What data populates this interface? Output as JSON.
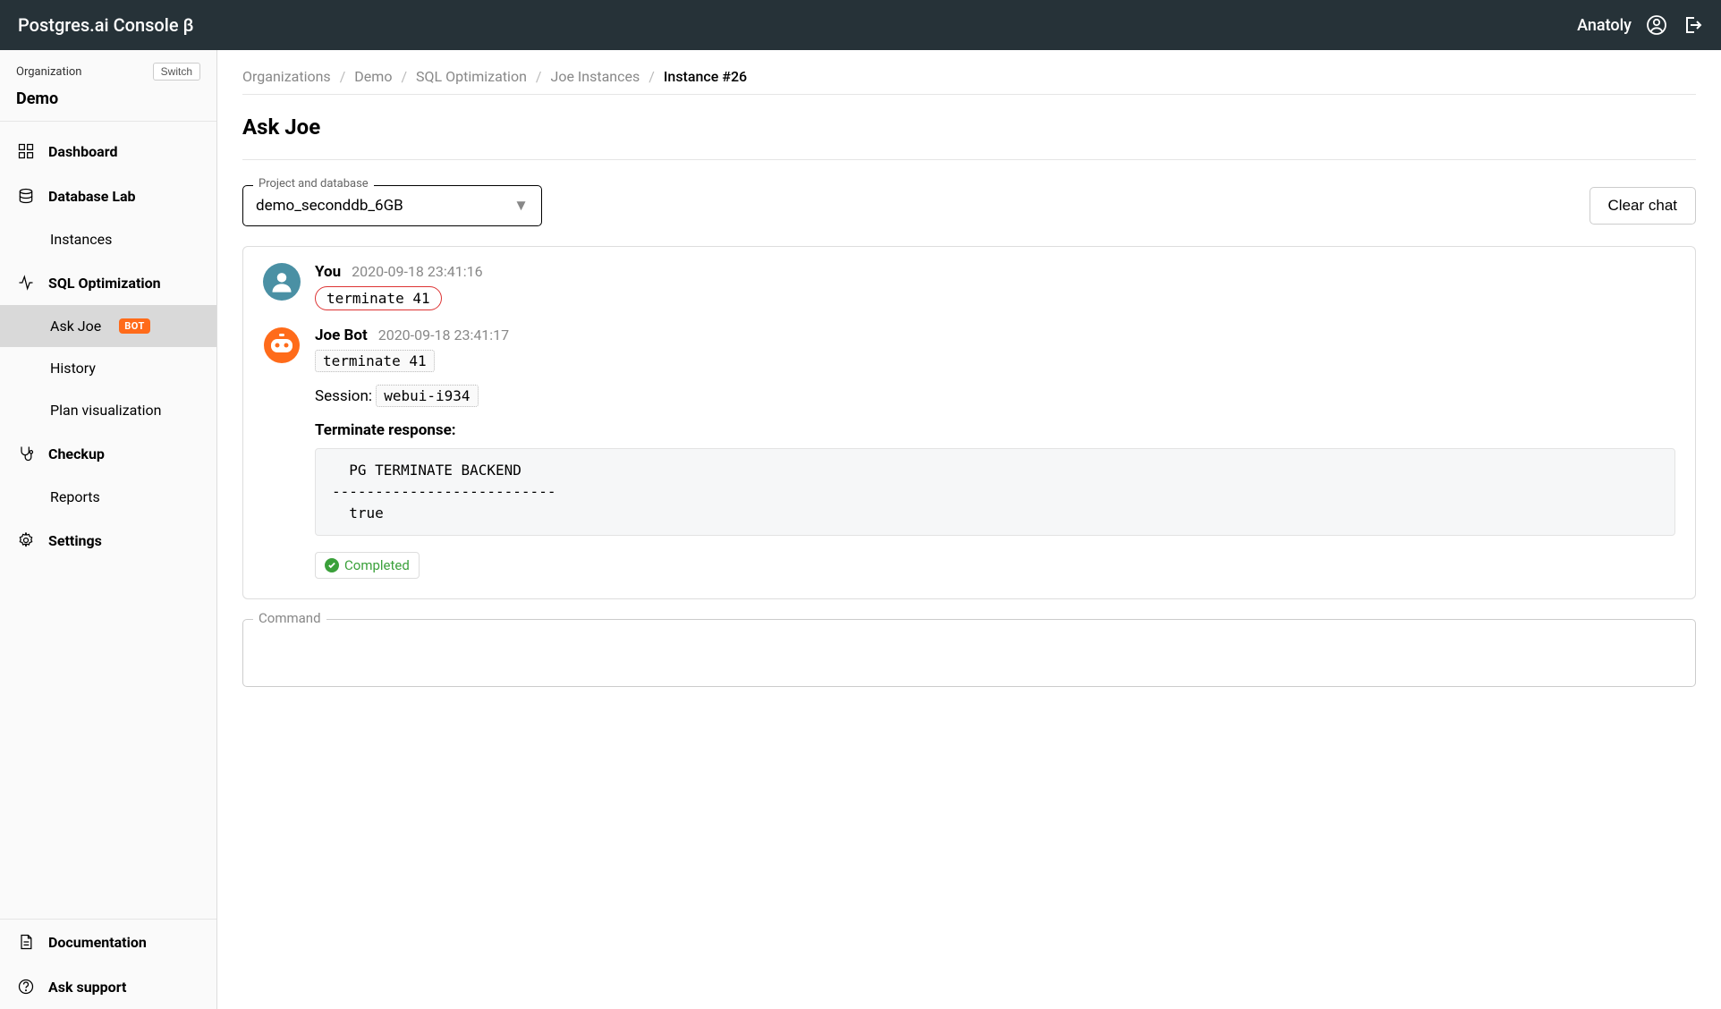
{
  "header": {
    "title": "Postgres.ai Console β",
    "user": "Anatoly"
  },
  "sidebar": {
    "org_label": "Organization",
    "switch_label": "Switch",
    "org_name": "Demo",
    "dashboard": "Dashboard",
    "database_lab": "Database Lab",
    "instances": "Instances",
    "sql_optimization": "SQL Optimization",
    "ask_joe": "Ask Joe",
    "bot_badge": "BOT",
    "history": "History",
    "plan_viz": "Plan visualization",
    "checkup": "Checkup",
    "reports": "Reports",
    "settings": "Settings",
    "documentation": "Documentation",
    "ask_support": "Ask support"
  },
  "breadcrumb": {
    "items": [
      "Organizations",
      "Demo",
      "SQL Optimization",
      "Joe Instances"
    ],
    "current": "Instance #26"
  },
  "page": {
    "title": "Ask Joe",
    "select_label": "Project and database",
    "select_value": "demo_seconddb_6GB",
    "clear_chat": "Clear chat"
  },
  "chat": {
    "user": {
      "author": "You",
      "time": "2020-09-18 23:41:16",
      "command": "terminate 41"
    },
    "bot": {
      "author": "Joe Bot",
      "time": "2020-09-18 23:41:17",
      "echoed": "terminate 41",
      "session_label": "Session:",
      "session_id": "webui-i934",
      "response_heading": "Terminate response:",
      "response_body": "  PG TERMINATE BACKEND\n--------------------------\n  true",
      "status": "Completed"
    }
  },
  "command_input": {
    "label": "Command",
    "value": ""
  }
}
